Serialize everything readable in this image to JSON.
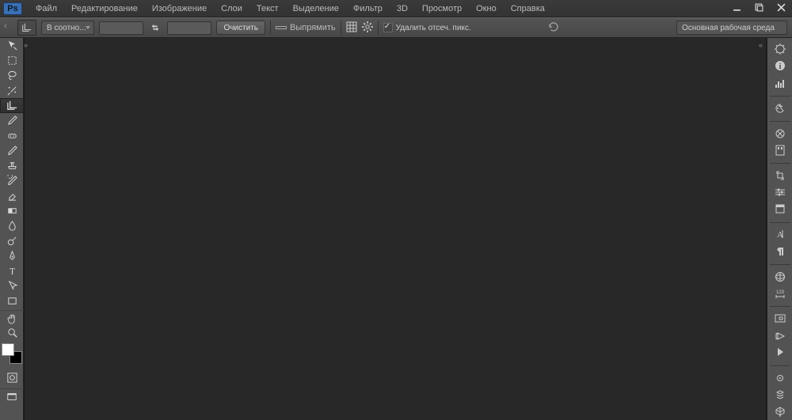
{
  "logo": "Ps",
  "menus": [
    "Файл",
    "Редактирование",
    "Изображение",
    "Слои",
    "Текст",
    "Выделение",
    "Фильтр",
    "3D",
    "Просмотр",
    "Окно",
    "Справка"
  ],
  "optbar": {
    "ratio_preset": "В соотно...",
    "clear": "Очистить",
    "straighten": "Выпрямить",
    "delete_cropped": "Удалить отсеч. пикс."
  },
  "workspace": "Основная рабочая среда",
  "tools": {
    "left": [
      "move",
      "marquee",
      "lasso",
      "wand",
      "crop",
      "eyedropper",
      "healing",
      "brush",
      "stamp",
      "history-brush",
      "eraser",
      "gradient",
      "blur",
      "dodge",
      "pen",
      "type",
      "path-select",
      "rectangle",
      "hand",
      "zoom"
    ],
    "right_panels": [
      "color-panel",
      "info-panel",
      "histogram-panel",
      "swatches-panel",
      "brush-panel",
      "brush-presets-panel",
      "clone-source-panel",
      "tool-presets-panel",
      "layer-comps-panel",
      "character-panel",
      "paragraph-panel",
      "3d-panel",
      "measurement-panel",
      "navigator-panel",
      "timeline-panel",
      "actions-panel",
      "properties-panel",
      "layers-panel",
      "channels-panel"
    ]
  }
}
